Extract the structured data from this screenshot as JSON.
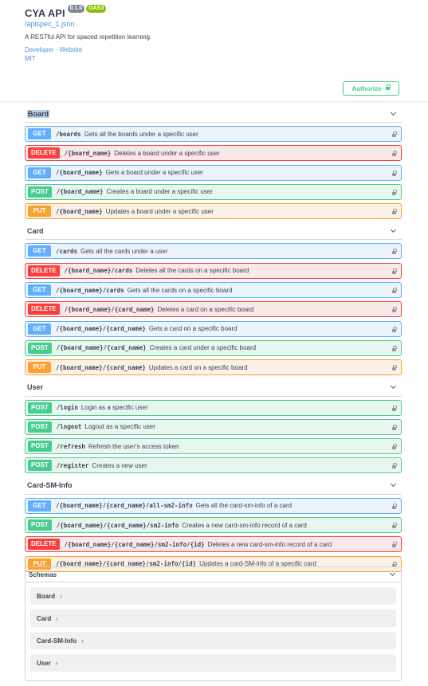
{
  "info": {
    "title": "CYA API",
    "version": "0.1.0",
    "oas": "OAS3",
    "spec_url": "/apispec_1.json",
    "description": "A RESTful API for spaced repetition learning.",
    "developer_link": "Developer - Website",
    "license": "MIT"
  },
  "authorize_label": "Authorize",
  "tags": [
    {
      "name": "Board",
      "ops": [
        {
          "method": "GET",
          "path": "/boards",
          "summary": "Gets all the boards under a specific user"
        },
        {
          "method": "DELETE",
          "path": "/{board_name}",
          "summary": "Deletes a board under a specific user"
        },
        {
          "method": "GET",
          "path": "/{board_name}",
          "summary": "Gets a board under a specific user"
        },
        {
          "method": "POST",
          "path": "/{board_name}",
          "summary": "Creates a board under a specific user"
        },
        {
          "method": "PUT",
          "path": "/{board_name}",
          "summary": "Updates a board under a specific user"
        }
      ]
    },
    {
      "name": "Card",
      "ops": [
        {
          "method": "GET",
          "path": "/cards",
          "summary": "Gets all the cards under a user"
        },
        {
          "method": "DELETE",
          "path": "/{board_name}/cards",
          "summary": "Deletes all the cards on a specific board"
        },
        {
          "method": "GET",
          "path": "/{board_name}/cards",
          "summary": "Gets all the cards on a specific board"
        },
        {
          "method": "DELETE",
          "path": "/{board_name}/{card_name}",
          "summary": "Deletes a card on a specific board"
        },
        {
          "method": "GET",
          "path": "/{board_name}/{card_name}",
          "summary": "Gets a card on a specific board"
        },
        {
          "method": "POST",
          "path": "/{board_name}/{card_name}",
          "summary": "Creates a card under a specific board"
        },
        {
          "method": "PUT",
          "path": "/{board_name}/{card_name}",
          "summary": "Updates a card on a specific board"
        }
      ]
    },
    {
      "name": "User",
      "ops": [
        {
          "method": "POST",
          "path": "/login",
          "summary": "Login as a specific user"
        },
        {
          "method": "POST",
          "path": "/logout",
          "summary": "Logout as a specific user"
        },
        {
          "method": "POST",
          "path": "/refresh",
          "summary": "Refresh the user's access token"
        },
        {
          "method": "POST",
          "path": "/register",
          "summary": "Creates a new user"
        }
      ]
    },
    {
      "name": "Card-SM-Info",
      "ops": [
        {
          "method": "GET",
          "path": "/{board_name}/{card_name}/all-sm2-info",
          "summary": "Gets all the card-sm-info of a card"
        },
        {
          "method": "POST",
          "path": "/{board_name}/{card_name}/sm2-info",
          "summary": "Creates a new card-sm-info record of a card"
        },
        {
          "method": "DELETE",
          "path": "/{board_name}/{card_name}/sm2-info/{id}",
          "summary": "Deletes a new card-sm-info record of a card"
        },
        {
          "method": "PUT",
          "path": "/{board_name}/{card_name}/sm2-info/{id}",
          "summary": "Updates a card-SM-info of a specific card"
        }
      ]
    }
  ],
  "schemas": {
    "title": "Schemas",
    "models": [
      "Board",
      "Card",
      "Card-SM-Info",
      "User"
    ]
  },
  "colors": {
    "get": "#61affe",
    "post": "#49cc90",
    "put": "#fca130",
    "delete": "#f93e3e"
  }
}
